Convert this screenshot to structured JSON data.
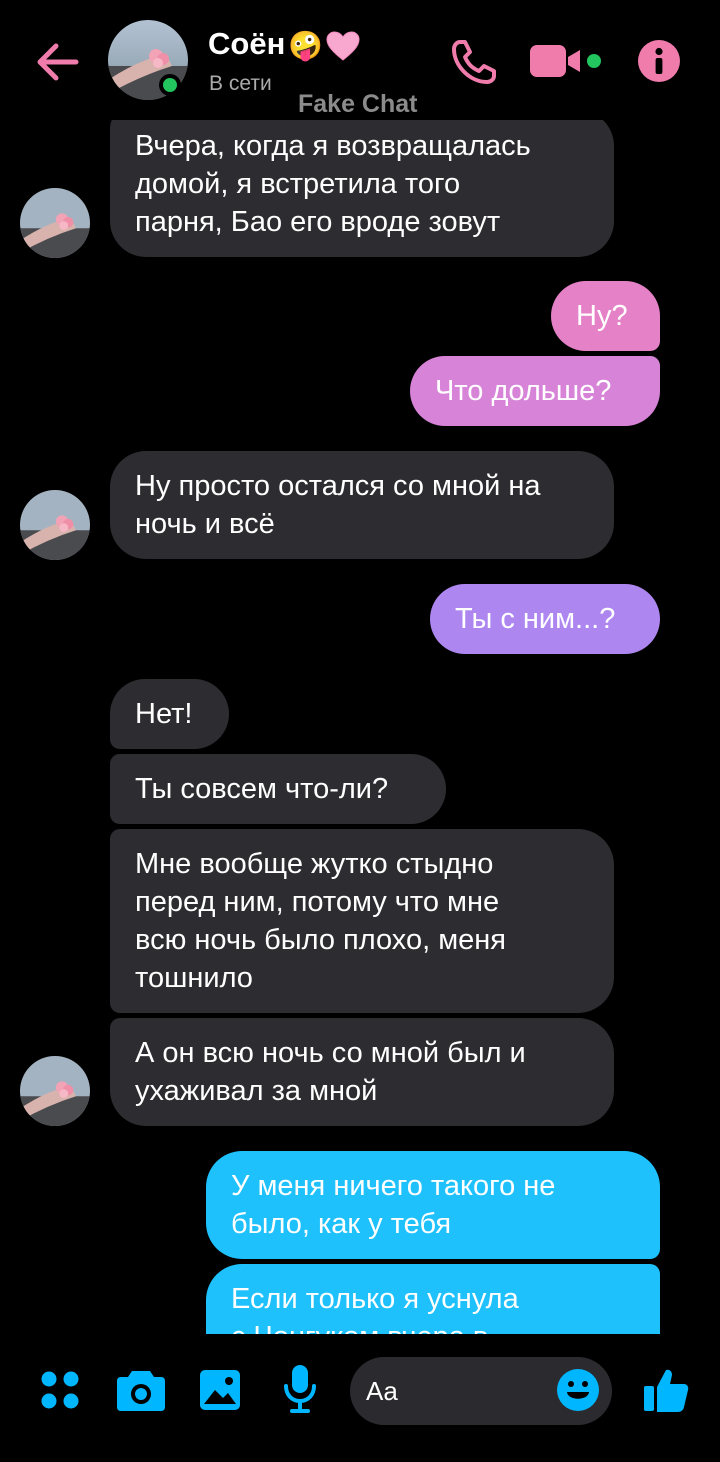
{
  "header": {
    "contact_name": "Соён",
    "name_emoji": "🤪",
    "status": "В сети",
    "watermark": "Fake Chat"
  },
  "messages": [
    {
      "from": "contact",
      "lines": [
        "Вчера, когда я возвращалась",
        "домой, я встретила того",
        "парня,  Бао его вроде зовут"
      ]
    },
    {
      "from": "me",
      "lines": [
        "Ну?"
      ]
    },
    {
      "from": "me",
      "lines": [
        "Что дольше?"
      ]
    },
    {
      "from": "contact",
      "lines": [
        "Ну просто остался со мной на",
        "ночь и всё"
      ]
    },
    {
      "from": "me",
      "lines": [
        "Ты с ним...?"
      ]
    },
    {
      "from": "contact",
      "lines": [
        "Нет!"
      ]
    },
    {
      "from": "contact",
      "lines": [
        "Ты совсем что-ли?"
      ]
    },
    {
      "from": "contact",
      "lines": [
        "Мне вообще жутко стыдно",
        "перед ним, потому что мне",
        "всю ночь было плохо, меня",
        "тошнило"
      ]
    },
    {
      "from": "contact",
      "lines": [
        "А он всю ночь со мной был и",
        "ухаживал за мной"
      ]
    },
    {
      "from": "me",
      "lines": [
        "У меня ничего такого не",
        "было, как у тебя"
      ]
    },
    {
      "from": "me",
      "lines": [
        "Если только я уснула",
        "с Чонгуком вчера в"
      ]
    }
  ],
  "composer": {
    "placeholder": "Aa",
    "icons": [
      "apps-icon",
      "camera-icon",
      "image-icon",
      "mic-icon",
      "emoji-icon",
      "thumbs-up-icon"
    ]
  },
  "colors": {
    "accent_pink": "#f07cac",
    "accent_blue": "#00b6ff",
    "bubble_incoming": "#2d2c30",
    "bubble_pink": "#e582c7",
    "bubble_pink2": "#d783d8",
    "bubble_purple": "#ad86f0",
    "bubble_blue": "#1ec1fb",
    "online": "#22c55e"
  }
}
